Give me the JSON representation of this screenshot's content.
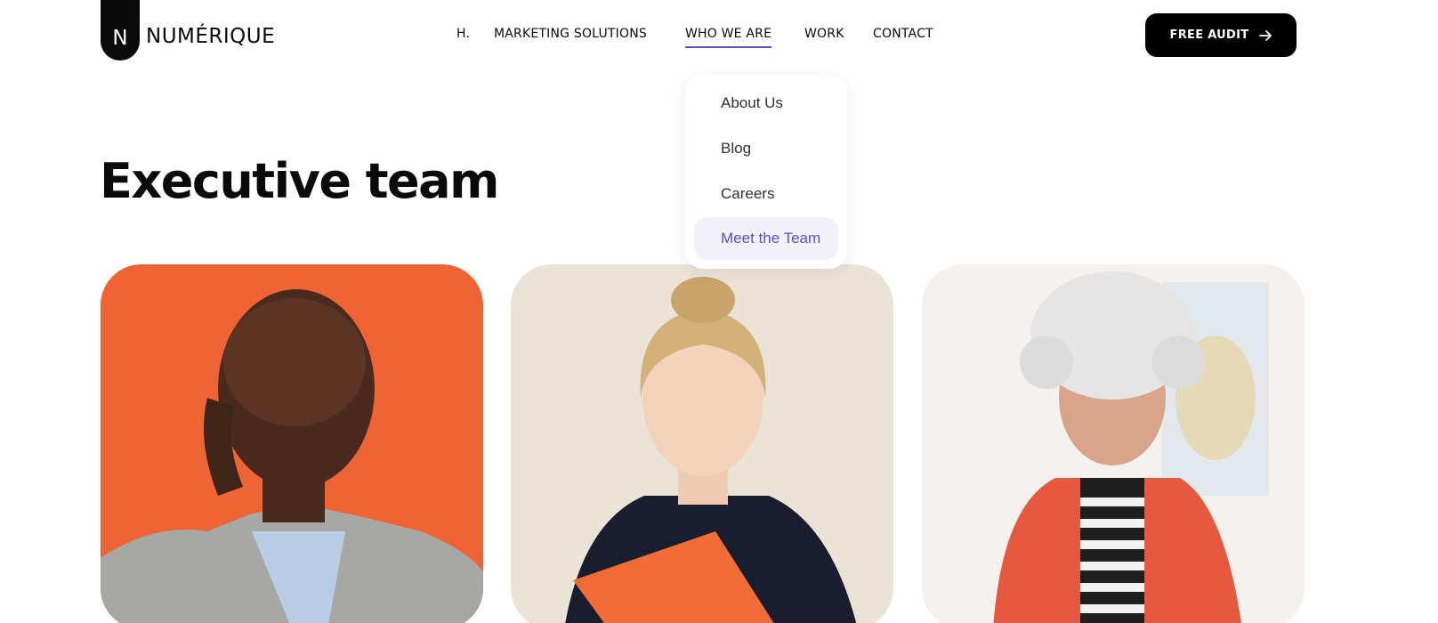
{
  "header": {
    "logo_mark": "N",
    "logo_text": "NUMÉRIQUE",
    "nav": [
      {
        "label": "H."
      },
      {
        "label": "MARKETING SOLUTIONS"
      },
      {
        "label": "WHO WE ARE",
        "active": true
      },
      {
        "label": "WORK"
      },
      {
        "label": "CONTACT"
      }
    ],
    "cta_label": "FREE AUDIT",
    "cta_icon": "arrow-right-icon"
  },
  "dropdown": {
    "items": [
      {
        "label": "About Us"
      },
      {
        "label": "Blog"
      },
      {
        "label": "Careers"
      },
      {
        "label": "Meet the Team",
        "selected": true
      }
    ]
  },
  "main": {
    "title": "Executive team"
  },
  "colors": {
    "accent": "#5b4fd6",
    "dropdown_selected_bg": "#f3f2fb",
    "cta_bg": "#000000",
    "card1_bg": "#f26b3a",
    "card2_bg": "#ebe3d6",
    "card3_bg": "#f4f1ee"
  }
}
